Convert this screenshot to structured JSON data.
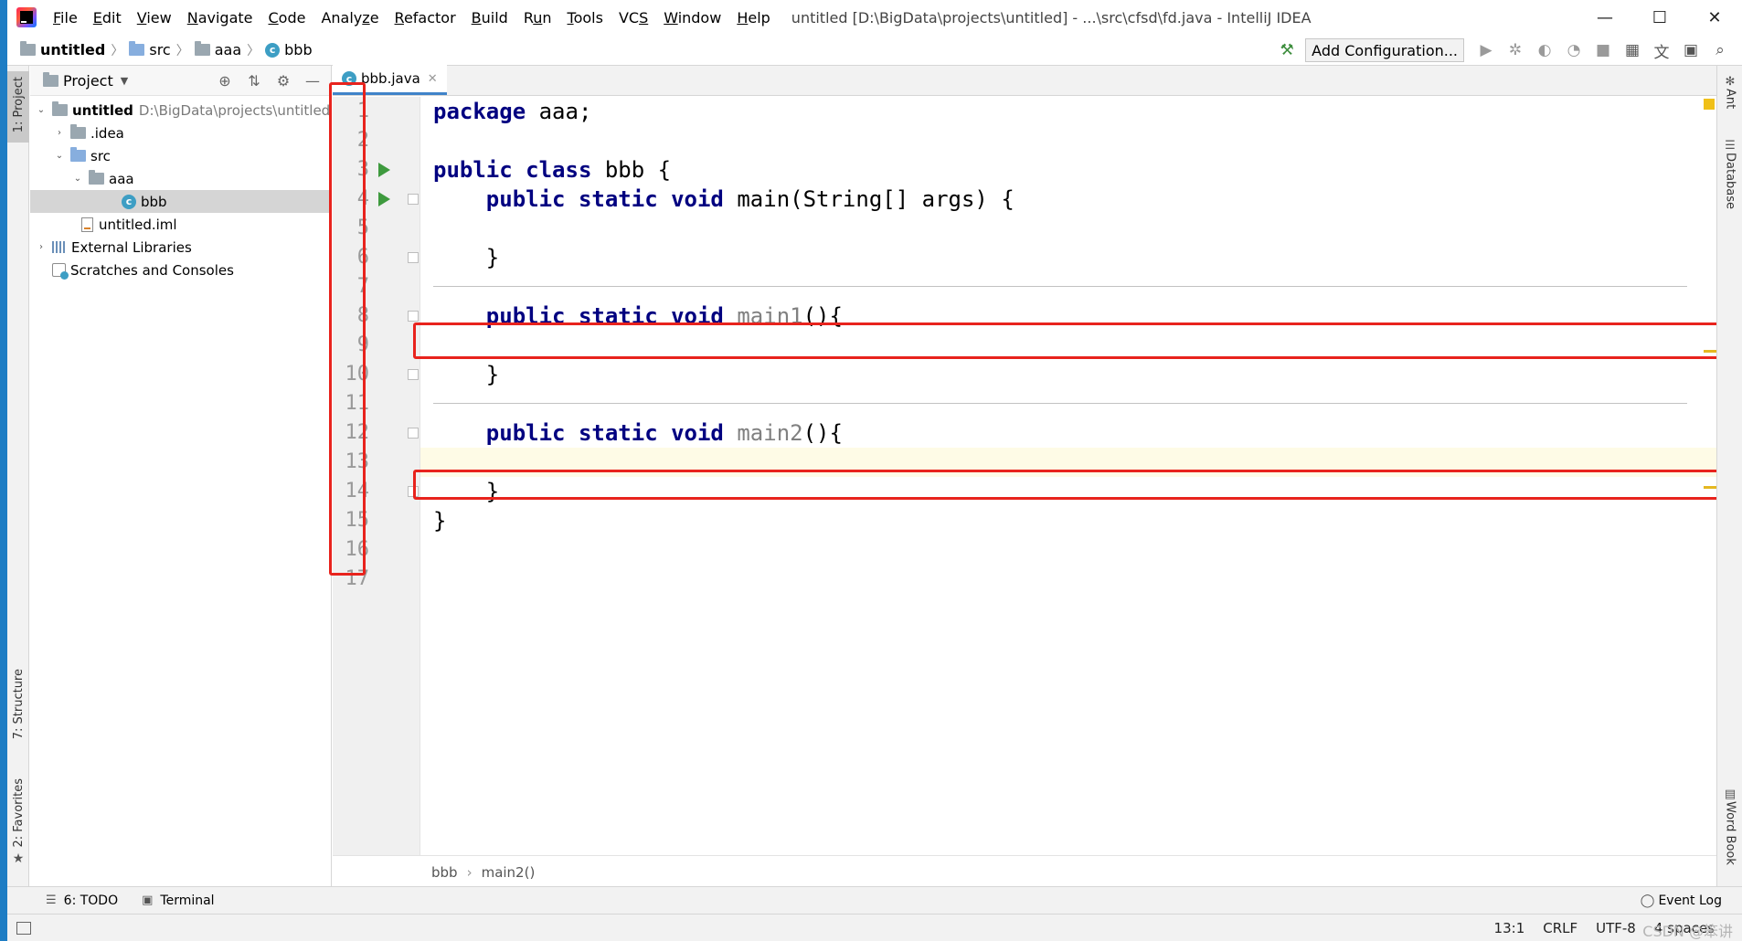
{
  "window": {
    "menu": [
      {
        "label": "File",
        "mn": "F"
      },
      {
        "label": "Edit",
        "mn": "E"
      },
      {
        "label": "View",
        "mn": "V"
      },
      {
        "label": "Navigate",
        "mn": "N"
      },
      {
        "label": "Code",
        "mn": "C"
      },
      {
        "label": "Analyze",
        "mn": "z"
      },
      {
        "label": "Refactor",
        "mn": "R"
      },
      {
        "label": "Build",
        "mn": "B"
      },
      {
        "label": "Run",
        "mn": "u"
      },
      {
        "label": "Tools",
        "mn": "T"
      },
      {
        "label": "VCS",
        "mn": "S"
      },
      {
        "label": "Window",
        "mn": "W"
      },
      {
        "label": "Help",
        "mn": "H"
      }
    ],
    "title": "untitled [D:\\BigData\\projects\\untitled] - ...\\src\\cfsd\\fd.java - IntelliJ IDEA",
    "controls": {
      "minimize": "—",
      "maximize": "☐",
      "close": "✕"
    }
  },
  "navbar": {
    "crumbs": [
      "untitled",
      "src",
      "aaa",
      "bbb"
    ],
    "add_config": "Add Configuration..."
  },
  "left_stripe": {
    "project": "1: Project",
    "structure": "7: Structure",
    "favorites": "2: Favorites"
  },
  "project_panel": {
    "title": "Project",
    "tree": {
      "root": {
        "name": "untitled",
        "path": "D:\\BigData\\projects\\untitled"
      },
      "idea": ".idea",
      "src": "src",
      "aaa": "aaa",
      "bbb": "bbb",
      "iml": "untitled.iml",
      "libs": "External Libraries",
      "scratches": "Scratches and Consoles"
    }
  },
  "editor": {
    "tab": "bbb.java",
    "current_line": 13,
    "lines": [
      {
        "n": "1",
        "code": [
          {
            "t": "package",
            "k": 1
          },
          {
            "t": " aaa;"
          }
        ]
      },
      {
        "n": "2",
        "code": []
      },
      {
        "n": "3",
        "code": [
          {
            "t": "public class",
            "k": 1
          },
          {
            "t": " bbb {"
          }
        ],
        "run": true
      },
      {
        "n": "4",
        "code": [
          {
            "t": "    "
          },
          {
            "t": "public static void",
            "k": 1
          },
          {
            "t": " main(String[] args) {"
          }
        ],
        "run": true,
        "fold": true
      },
      {
        "n": "5",
        "code": []
      },
      {
        "n": "6",
        "code": [
          {
            "t": "    }"
          }
        ],
        "fold": true
      },
      {
        "n": "7",
        "code": []
      },
      {
        "n": "8",
        "code": [
          {
            "t": "    "
          },
          {
            "t": "public static void",
            "k": 1
          },
          {
            "t": " "
          },
          {
            "t": "main1",
            "u": 1
          },
          {
            "t": "(){"
          }
        ],
        "fold": true
      },
      {
        "n": "9",
        "code": []
      },
      {
        "n": "10",
        "code": [
          {
            "t": "    }"
          }
        ],
        "fold": true
      },
      {
        "n": "11",
        "code": []
      },
      {
        "n": "12",
        "code": [
          {
            "t": "    "
          },
          {
            "t": "public static void",
            "k": 1
          },
          {
            "t": " "
          },
          {
            "t": "main2",
            "u": 1
          },
          {
            "t": "(){"
          }
        ],
        "fold": true
      },
      {
        "n": "13",
        "code": []
      },
      {
        "n": "14",
        "code": [
          {
            "t": "    }"
          }
        ],
        "fold": true
      },
      {
        "n": "15",
        "code": [
          {
            "t": "}"
          }
        ]
      },
      {
        "n": "16",
        "code": []
      },
      {
        "n": "17",
        "code": []
      }
    ],
    "breadcrumb": [
      "bbb",
      "main2()"
    ]
  },
  "right_stripe": {
    "ant": "Ant",
    "database": "Database",
    "wordbook": "Word Book"
  },
  "bottom_tools": {
    "todo": "6: TODO",
    "terminal": "Terminal",
    "event_log": "Event Log"
  },
  "status": {
    "position": "13:1",
    "line_sep": "CRLF",
    "encoding": "UTF-8",
    "indent": "4 spaces"
  },
  "watermark": "CSDN @笨讲",
  "colors": {
    "keyword": "#000080",
    "unused": "#808080",
    "highlight_box": "#e8231d",
    "current_line": "#fefbe6"
  }
}
